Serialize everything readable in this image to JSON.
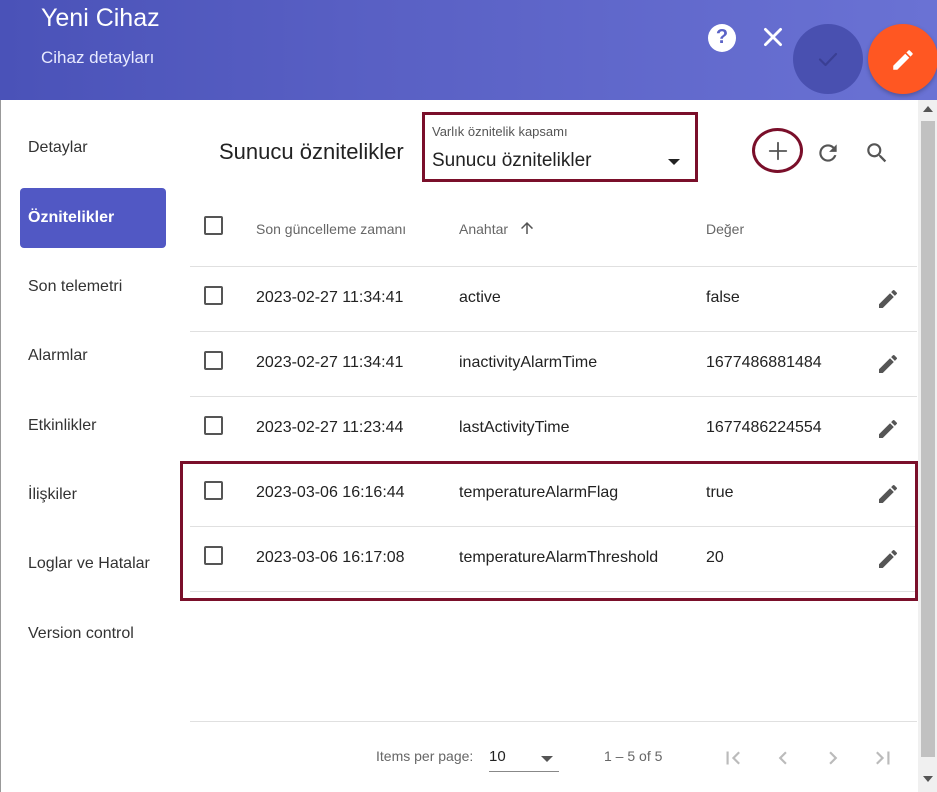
{
  "header": {
    "title": "Yeni Cihaz",
    "subtitle": "Cihaz detayları",
    "help_label": "?"
  },
  "sidebar": {
    "items": [
      {
        "label": "Detaylar",
        "active": false
      },
      {
        "label": "Öznitelikler",
        "active": true
      },
      {
        "label": "Son telemetri",
        "active": false
      },
      {
        "label": "Alarmlar",
        "active": false
      },
      {
        "label": "Etkinlikler",
        "active": false
      },
      {
        "label": "İlişkiler",
        "active": false
      },
      {
        "label": "Loglar ve Hatalar",
        "active": false
      },
      {
        "label": "Version control",
        "active": false
      }
    ]
  },
  "main": {
    "section_title": "Sunucu öznitelikler",
    "scope": {
      "caption": "Varlık öznitelik kapsamı",
      "value": "Sunucu öznitelikler"
    },
    "table": {
      "columns": [
        "Son güncelleme zamanı",
        "Anahtar",
        "Değer"
      ],
      "sort_column": "Anahtar",
      "sort_direction": "ascending",
      "rows": [
        {
          "time": "2023-02-27 11:34:41",
          "key": "active",
          "value": "false"
        },
        {
          "time": "2023-02-27 11:34:41",
          "key": "inactivityAlarmTime",
          "value": "1677486881484"
        },
        {
          "time": "2023-02-27 11:23:44",
          "key": "lastActivityTime",
          "value": "1677486224554"
        },
        {
          "time": "2023-03-06 16:16:44",
          "key": "temperatureAlarmFlag",
          "value": "true"
        },
        {
          "time": "2023-03-06 16:17:08",
          "key": "temperatureAlarmThreshold",
          "value": "20"
        }
      ]
    },
    "paginator": {
      "items_per_page_label": "Items per page:",
      "items_per_page": "10",
      "range": "1 – 5 of 5"
    }
  },
  "colors": {
    "header_start": "#4a52b8",
    "header_end": "#6a72d4",
    "active_tab": "#5158c4",
    "fab_edit": "#ff5722",
    "highlight": "#7a0f2a"
  },
  "icons": [
    "help-icon",
    "close-icon",
    "check-icon",
    "pencil-icon",
    "add-icon",
    "refresh-icon",
    "search-icon",
    "sort-arrow-up-icon",
    "first-page-icon",
    "prev-page-icon",
    "next-page-icon",
    "last-page-icon"
  ]
}
